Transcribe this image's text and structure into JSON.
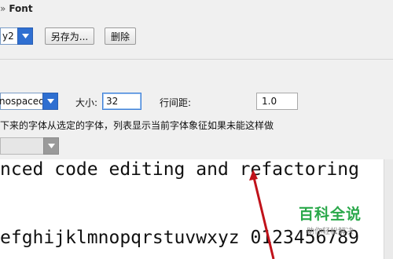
{
  "header": {
    "breadcrumb_sep": "»",
    "title": "Font"
  },
  "scheme": {
    "value": "y2",
    "save_as_label": "另存为...",
    "delete_label": "删除"
  },
  "font": {
    "family_value": "nospaced",
    "size_label": "大小:",
    "size_value": "32",
    "line_spacing_label": "行间距:",
    "line_spacing_value": "1.0",
    "fallback_hint": "下来的字体从选定的字体，列表显示当前字体象征如果未能这样做"
  },
  "preview": {
    "line1": "nced code editing and refactoring",
    "line2": "efghijklmnopqrstuvwxyz 0123456789"
  },
  "watermark": {
    "title": "百科全说",
    "subtitle": "助你轻松解决"
  },
  "colors": {
    "accent": "#2f6fd1",
    "annotation_arrow": "#c0121a",
    "watermark_green": "#2aa84a"
  }
}
